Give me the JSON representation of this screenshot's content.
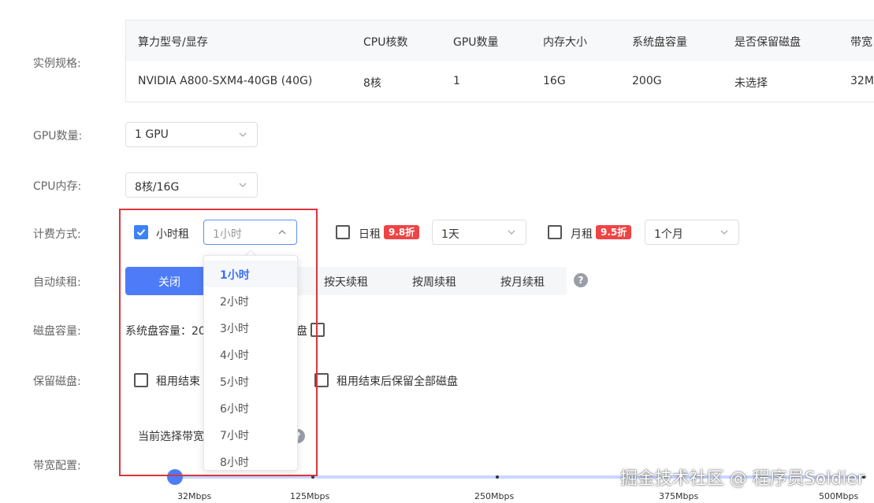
{
  "labels": {
    "instance_spec": "实例规格:",
    "gpu_count": "GPU数量:",
    "cpu_memory": "CPU内存:",
    "billing": "计费方式:",
    "auto_renew": "自动续租:",
    "disk": "磁盘容量:",
    "keep_disk": "保留磁盘:",
    "bandwidth": "带宽配置:"
  },
  "spec_table": {
    "headers": [
      "算力型号/显存",
      "CPU核数",
      "GPU数量",
      "内存大小",
      "系统盘容量",
      "是否保留磁盘",
      "带宽"
    ],
    "row": [
      "NVIDIA A800-SXM4-40GB (40G)",
      "8核",
      "1",
      "16G",
      "200G",
      "未选择",
      "32M"
    ]
  },
  "gpu_select": {
    "value": "1 GPU"
  },
  "cpu_select": {
    "value": "8核/16G"
  },
  "billing": {
    "hourly": {
      "label": "小时租",
      "checked": true,
      "select_placeholder": "1小时"
    },
    "daily": {
      "label": "日租",
      "checked": false,
      "badge": "9.8折",
      "select_value": "1天"
    },
    "monthly": {
      "label": "月租",
      "checked": false,
      "badge": "9.5折",
      "select_value": "1个月"
    }
  },
  "auto_renew": {
    "options": [
      "关闭",
      "按天续租",
      "按周续租",
      "按月续租"
    ],
    "selected": "关闭",
    "help": "?"
  },
  "disk": {
    "text_left": "系统盘容量：20",
    "text_right": "盘"
  },
  "keep_disk": {
    "option1": "租用结束",
    "option2": "租用结束后保留全部磁盘"
  },
  "bandwidth": {
    "current_prefix": "当前选择带宽",
    "help": "?",
    "minus": "—",
    "ticks": [
      "32Mbps",
      "125Mbps",
      "250Mbps",
      "375Mbps",
      "500Mbps"
    ]
  },
  "hour_dropdown": {
    "options": [
      "1小时",
      "2小时",
      "3小时",
      "4小时",
      "5小时",
      "6小时",
      "7小时",
      "8小时"
    ],
    "selected": "1小时"
  },
  "watermark": "掘金技术社区 @ 程序员Soldier",
  "colors": {
    "primary": "#4e7cf8",
    "checkbox": "#3b82f6",
    "badge": "#ef4444",
    "highlight_frame": "#d9363e",
    "track": "#c9d6ff"
  }
}
